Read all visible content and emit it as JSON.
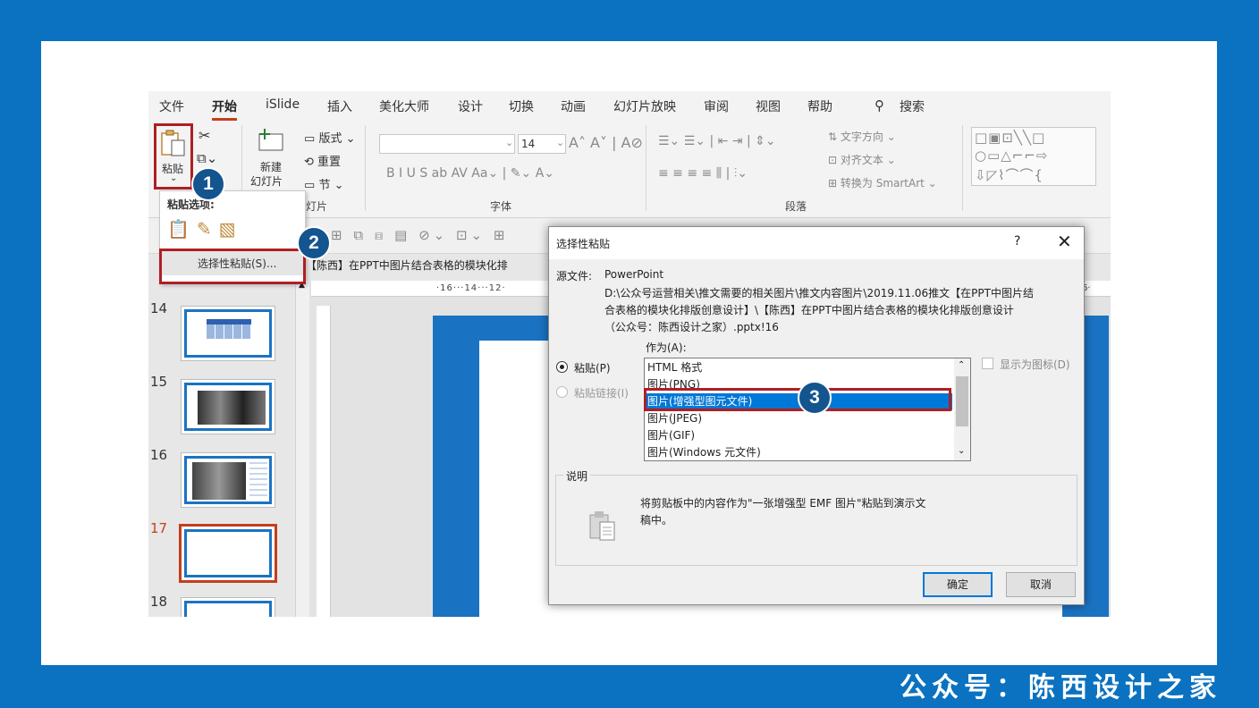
{
  "tabs": [
    "文件",
    "开始",
    "iSlide",
    "插入",
    "美化大师",
    "设计",
    "切换",
    "动画",
    "幻灯片放映",
    "审阅",
    "视图",
    "帮助",
    "搜索"
  ],
  "ribbon": {
    "paste": "粘贴",
    "new_slide_1": "新建",
    "new_slide_2": "幻灯片",
    "layout": "版式",
    "reset": "重置",
    "section": "节",
    "slides_group": "灯片",
    "font_size": "14",
    "font_group": "字体",
    "text_direction": "文字方向",
    "align_text": "对齐文本",
    "convert_smartart": "转换为 SmartArt",
    "paragraph_group": "段落"
  },
  "paste_menu": {
    "title": "粘贴选项:",
    "special": "选择性粘贴(S)..."
  },
  "doc_tab": "【陈西】在PPT中图片结合表格的模块化排",
  "ruler": {
    "h": "·16···14···12·",
    "right": "6·"
  },
  "slides": [
    "14",
    "15",
    "16",
    "17",
    "18"
  ],
  "dialog": {
    "title": "选择性粘贴",
    "help": "?",
    "close": "✕",
    "source_label": "源文件:",
    "source_app": "PowerPoint",
    "source_line1": "D:\\公众号运营相关\\推文需要的相关图片\\推文内容图片\\2019.11.06推文【在PPT中图片结",
    "source_line2": "合表格的模块化排版创意设计】\\【陈西】在PPT中图片结合表格的模块化排版创意设计",
    "source_line3": "（公众号：陈西设计之家）.pptx!16",
    "as_label": "作为(A):",
    "radio_paste": "粘贴(P)",
    "radio_link": "粘贴链接(I)",
    "formats": [
      "HTML 格式",
      "图片(PNG)",
      "图片(增强型图元文件)",
      "图片(JPEG)",
      "图片(GIF)",
      "图片(Windows 元文件)"
    ],
    "show_icon": "显示为图标(D)",
    "desc_label": "说明",
    "desc_line1": "将剪贴板中的内容作为\"一张增强型 EMF 图片\"粘贴到演示文",
    "desc_line2": "稿中。",
    "ok": "确定",
    "cancel": "取消"
  },
  "badges": [
    "1",
    "2",
    "3"
  ],
  "footer": "公众号：陈西设计之家",
  "colors": {
    "frame": "#0a72c0",
    "accent": "#c43e1c",
    "highlight": "#b01e23",
    "badge": "#14548f",
    "selection": "#0078d7"
  }
}
